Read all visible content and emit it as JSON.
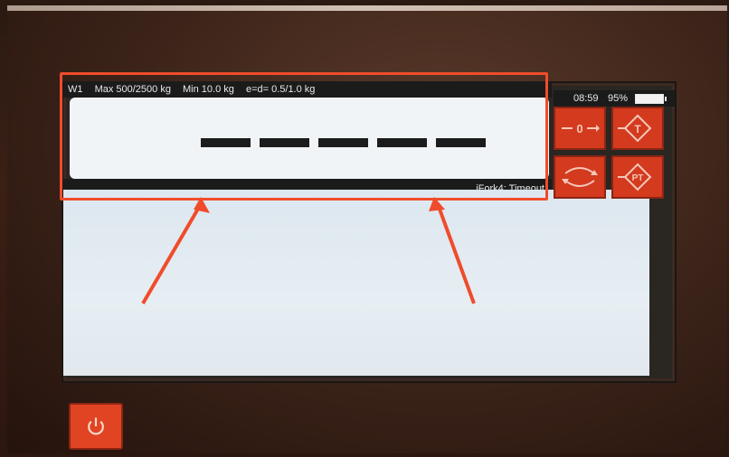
{
  "header": {
    "scale_id": "W1",
    "max": "Max 500/2500 kg",
    "min": "Min 10.0 kg",
    "division": "e=d= 0.5/1.0 kg"
  },
  "status": {
    "time": "08:59",
    "battery": "95%"
  },
  "display": {
    "reading_placeholder_dashes": 5
  },
  "footer": {
    "message": "iFork4: Timeout"
  },
  "keys": [
    {
      "name": "zero",
      "glyph": "0"
    },
    {
      "name": "tare",
      "glyph": "T"
    },
    {
      "name": "switch",
      "glyph": "⟲⟳"
    },
    {
      "name": "preset-tare",
      "glyph": "PT"
    }
  ],
  "colors": {
    "accent": "#d33a1e",
    "frame_highlight": "#f04c2c"
  }
}
